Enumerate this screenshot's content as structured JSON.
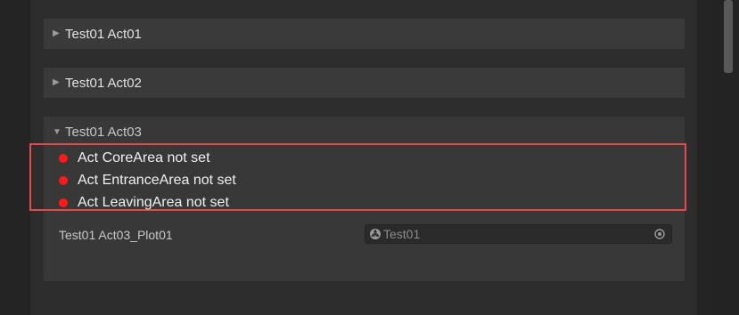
{
  "foldouts": [
    {
      "label": "Test01 Act01",
      "icon": "triangle-right-icon"
    },
    {
      "label": "Test01 Act02",
      "icon": "triangle-right-icon"
    }
  ],
  "expanded_section": {
    "label": "Test01 Act03",
    "icon": "triangle-down-icon",
    "warnings": [
      "Act CoreArea not set",
      "Act EntranceArea not set",
      "Act LeavingArea not set"
    ],
    "field": {
      "label": "Test01 Act03_Plot01",
      "value": "Test01",
      "value_icon": "object-icon",
      "picker_icon": "object-picker-icon"
    }
  },
  "colors": {
    "warning_dot": "#ff1a1a",
    "highlight_border": "#e24b4b",
    "panel_bg": "#2d2d2d",
    "foldout_bg": "#3a3a3a"
  }
}
